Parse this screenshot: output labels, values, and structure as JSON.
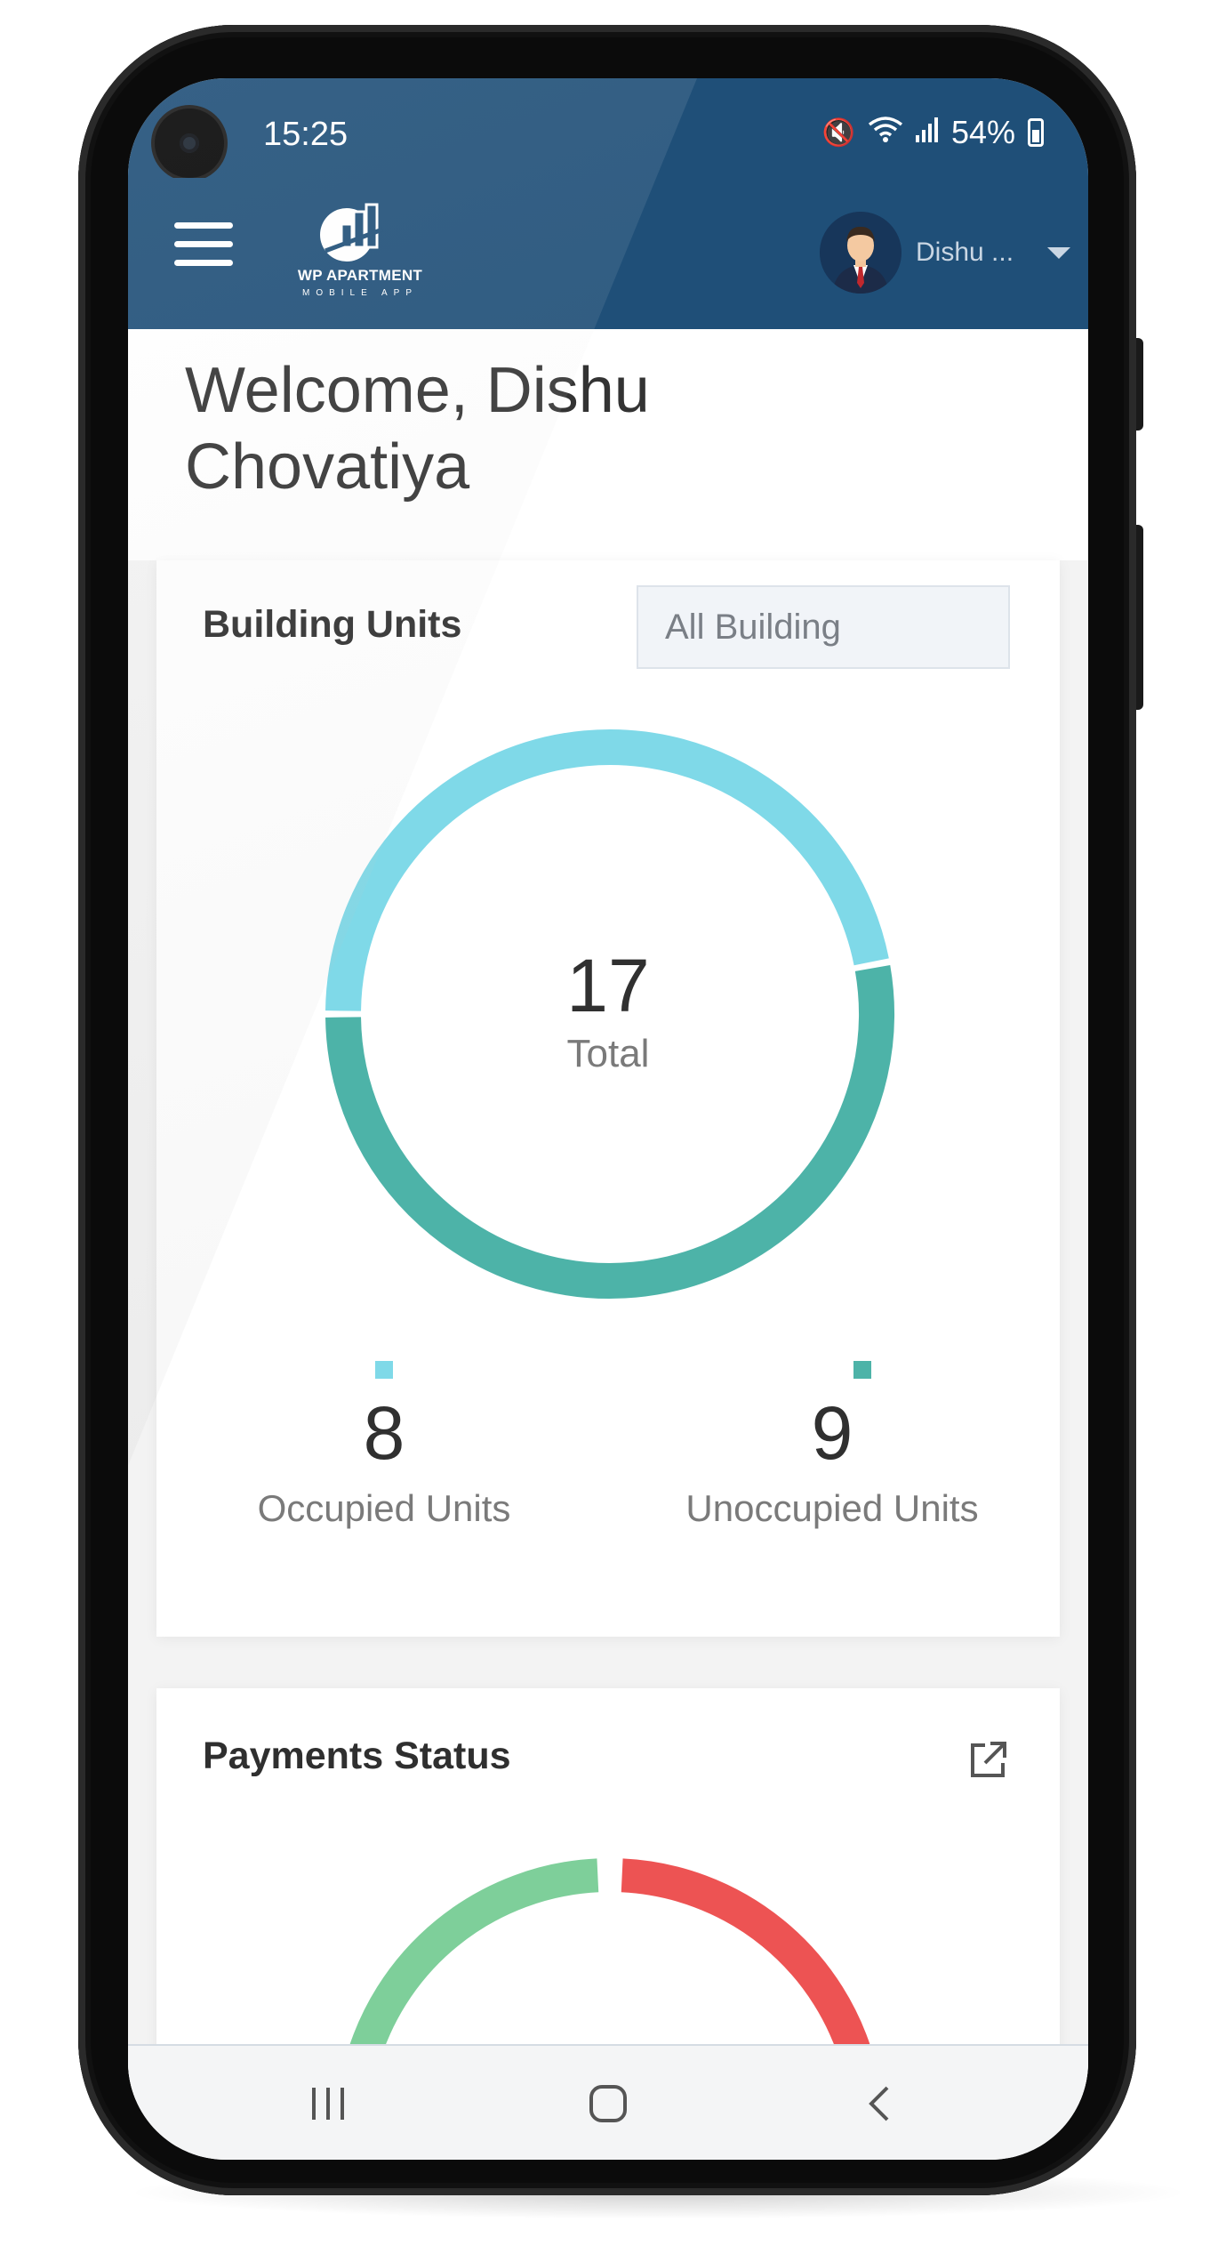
{
  "status_bar": {
    "time": "15:25",
    "battery": "54%",
    "icons": [
      "mute-icon",
      "wifi-icon",
      "signal-icon",
      "battery-icon"
    ]
  },
  "app_bar": {
    "logo_title": "WP APARTMENT",
    "logo_subtitle": "MOBILE APP",
    "user_name": "Dishu ...",
    "bar_color": "#1f4f78"
  },
  "welcome": {
    "line1": "Welcome, Dishu",
    "line2": "Chovatiya"
  },
  "building_units": {
    "title": "Building Units",
    "filter_value": "All Building",
    "total_value": "17",
    "total_label": "Total",
    "occupied": {
      "value": "8",
      "label": "Occupied Units",
      "color": "#7fd9e8"
    },
    "unoccupied": {
      "value": "9",
      "label": "Unoccupied Units",
      "color": "#4db3a8"
    }
  },
  "payments_status": {
    "title": "Payments Status",
    "colors": {
      "paid": "#7ecf9a",
      "unpaid": "#ed5353"
    }
  },
  "chart_data": {
    "type": "pie",
    "title": "Building Units",
    "slices": [
      {
        "label": "Occupied Units",
        "value": 8,
        "color": "#7fd9e8"
      },
      {
        "label": "Unoccupied Units",
        "value": 9,
        "color": "#4db3a8"
      }
    ],
    "center_value": 17,
    "center_label": "Total"
  },
  "nav_bar": {
    "icons": [
      "recent-apps-icon",
      "home-icon",
      "back-icon"
    ]
  }
}
